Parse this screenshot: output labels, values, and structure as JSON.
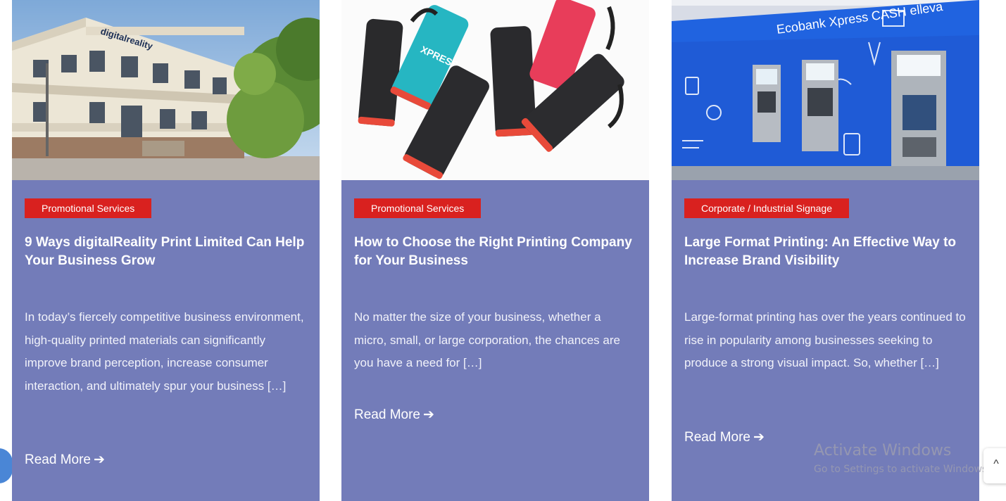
{
  "posts": [
    {
      "image_label": "digitalreality",
      "tag": "Promotional Services",
      "title": "9 Ways digitalReality Print Limited Can Help Your Business Grow",
      "excerpt": "In today’s fiercely competitive business environment, high-quality printed materials can significantly improve brand perception, increase consumer interaction, and ultimately spur your business […]",
      "read_more": "Read More"
    },
    {
      "image_label": "XPRESS",
      "tag": "Promotional Services",
      "title": "How to Choose the Right Printing Company for Your Business",
      "excerpt": "No matter the size of your business, whether a micro, small, or large corporation, the chances are you have a need for […]",
      "read_more": "Read More"
    },
    {
      "image_label": "Ecobank Xpress CASH elleva",
      "tag": "Corporate / Industrial Signage",
      "title": "Large Format Printing: An Effective Way to Increase Brand Visibility",
      "excerpt": "Large-format printing has over the years continued to rise in popularity among businesses seeking to produce a strong visual impact. So, whether […]",
      "read_more": "Read More"
    }
  ],
  "watermark": {
    "title": "Activate Windows",
    "subtitle": "Go to Settings to activate Windows."
  },
  "icons": {
    "read_more_arrow": "arrow-right-icon",
    "scroll_top": "chevron-up-icon",
    "chat": "chat-icon"
  },
  "colors": {
    "card_background": "#737cb9",
    "tag_background": "#d9211f",
    "text": "#ffffff"
  }
}
